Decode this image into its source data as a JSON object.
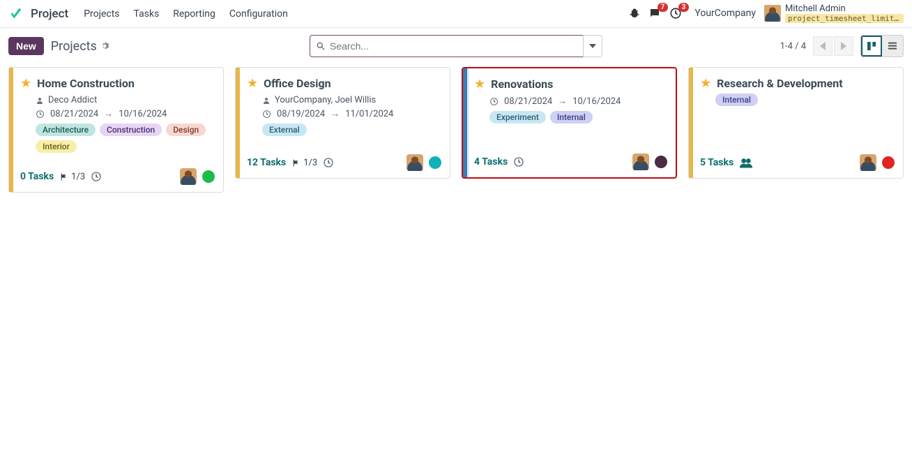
{
  "header": {
    "brand": "Project",
    "nav": [
      "Projects",
      "Tasks",
      "Reporting",
      "Configuration"
    ],
    "messages_badge": "7",
    "activities_badge": "3",
    "company": "YourCompany",
    "user_name": "Mitchell Admin",
    "user_detail": "project_timesheet_limit_…"
  },
  "toolbar": {
    "new_label": "New",
    "breadcrumb": "Projects",
    "search_placeholder": "Search...",
    "pager": "1-4 / 4"
  },
  "cards": [
    {
      "title": "Home Construction",
      "subtitle": "Deco Addict",
      "date_start": "08/21/2024",
      "date_end": "10/16/2024",
      "tags": [
        {
          "label": "Architecture",
          "bg": "#bfe6e1",
          "fg": "#215955"
        },
        {
          "label": "Construction",
          "bg": "#e6d5f5",
          "fg": "#4a2b6b"
        },
        {
          "label": "Design",
          "bg": "#f7d7cf",
          "fg": "#7a3d2d"
        },
        {
          "label": "Interior",
          "bg": "#f7eeaa",
          "fg": "#6a5d10"
        }
      ],
      "tasks": "0 Tasks",
      "milestone": "1/3",
      "accent": "#e6b74a",
      "status": "#1abc4b",
      "show_sub": true,
      "show_milestone": true,
      "show_people": false,
      "highlight": false
    },
    {
      "title": "Office Design",
      "subtitle": "YourCompany, Joel Willis",
      "date_start": "08/19/2024",
      "date_end": "11/01/2024",
      "tags": [
        {
          "label": "External",
          "bg": "#c9e7f3",
          "fg": "#2a5f77"
        }
      ],
      "tasks": "12 Tasks",
      "milestone": "1/3",
      "accent": "#e6b74a",
      "status": "#0fb2b8",
      "show_sub": true,
      "show_milestone": true,
      "show_people": false,
      "highlight": false
    },
    {
      "title": "Renovations",
      "subtitle": "",
      "date_start": "08/21/2024",
      "date_end": "10/16/2024",
      "tags": [
        {
          "label": "Experiment",
          "bg": "#c9e7f3",
          "fg": "#2a5f77"
        },
        {
          "label": "Internal",
          "bg": "#cfd0f2",
          "fg": "#3b3d8c"
        }
      ],
      "tasks": "4 Tasks",
      "milestone": "",
      "accent": "#3b7db5",
      "status": "#4a2b43",
      "show_sub": false,
      "show_milestone": false,
      "show_people": false,
      "highlight": true
    },
    {
      "title": "Research & Development",
      "subtitle": "",
      "date_start": "",
      "date_end": "",
      "tags": [
        {
          "label": "Internal",
          "bg": "#cfd0f2",
          "fg": "#3b3d8c"
        }
      ],
      "tasks": "5 Tasks",
      "milestone": "",
      "accent": "#e6b74a",
      "status": "#e02424",
      "show_sub": false,
      "show_milestone": false,
      "show_people": true,
      "highlight": false
    }
  ]
}
